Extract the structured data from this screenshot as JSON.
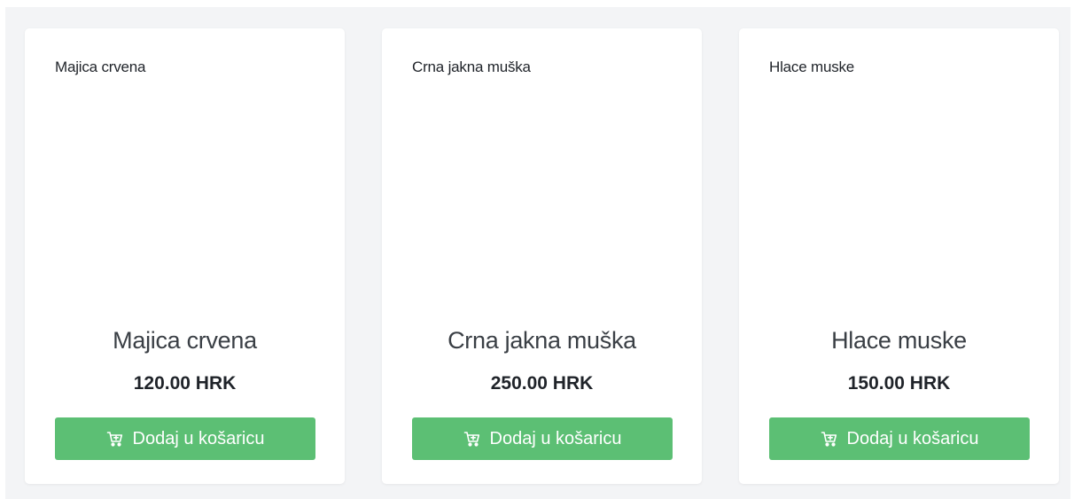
{
  "products": [
    {
      "header": "Majica crvena",
      "name": "Majica crvena",
      "price": "120.00 HRK",
      "button_label": "Dodaj u košaricu",
      "button_icon": "cart-plus-icon"
    },
    {
      "header": "Crna jakna muška",
      "name": "Crna jakna muška",
      "price": "250.00 HRK",
      "button_label": "Dodaj u košaricu",
      "button_icon": "cart-plus-icon"
    },
    {
      "header": "Hlace muske",
      "name": "Hlace muske",
      "price": "150.00 HRK",
      "button_label": "Dodaj u košaricu",
      "button_icon": "cart-plus-icon"
    }
  ],
  "colors": {
    "button_bg": "#5cbf74",
    "page_bg": "#f3f4f6",
    "card_bg": "#ffffff"
  }
}
